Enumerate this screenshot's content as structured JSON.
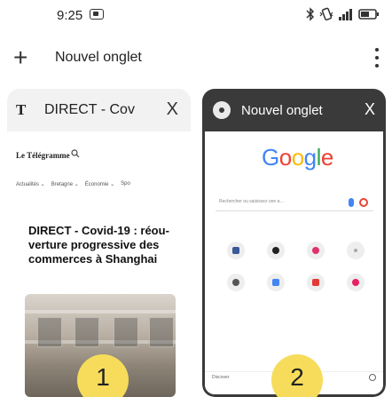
{
  "status_bar": {
    "time": "9:25",
    "icons": [
      "bluetooth-icon",
      "vibrate-icon",
      "signal-icon",
      "battery-icon"
    ]
  },
  "header": {
    "plus_symbol": "+",
    "new_tab_label": "Nouvel onglet"
  },
  "tabs": [
    {
      "title": "DIRECT - Cov",
      "favicon_letter": "T",
      "close_symbol": "X",
      "number": "1",
      "preview": {
        "site_logo": "Le Télégramme",
        "nav_items": [
          "Actualités ⌄",
          "Bretagne ⌄",
          "Économie ⌄",
          "Spo"
        ],
        "article_title": "DIRECT - Covid-19 : réou-verture progressive des commerces à Shanghai"
      }
    },
    {
      "title": "Nouvel onglet",
      "close_symbol": "X",
      "number": "2",
      "active": true,
      "preview": {
        "logo": "Google",
        "search_placeholder": "Rechercher ou saisissez une a…",
        "discover_label": "Discover"
      }
    }
  ],
  "colors": {
    "badge": "#f6dc5a",
    "active_tab_header": "#3a3a3a",
    "google_blue": "#4285f4",
    "google_red": "#ea4335",
    "google_yellow": "#fbbc05",
    "google_green": "#34a853"
  }
}
